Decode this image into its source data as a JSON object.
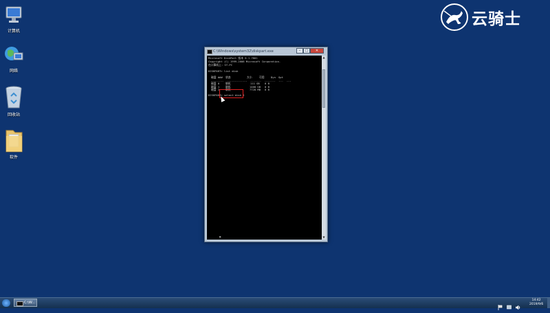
{
  "desktop": {
    "icons": [
      {
        "label": "计算机",
        "icon": "computer-icon"
      },
      {
        "label": "网络",
        "icon": "network-icon"
      },
      {
        "label": "回收站",
        "icon": "recycle-bin-icon"
      },
      {
        "label": "软件",
        "icon": "folder-icon"
      }
    ],
    "background_color": "#0e3470"
  },
  "watermark": {
    "text": "云骑士"
  },
  "cmd_window": {
    "title": "C:\\Windows\\system32\\diskpart.exe",
    "lines": {
      "l1": "Microsoft DiskPart 版本 6.1.7601",
      "l2": "Copyright (C) 1999-2008 Microsoft Corporation.",
      "l3": "在计算机上: ST-PC",
      "l4": "DISKPART> list disk",
      "l5": "DISKPART> select disk 2",
      "l6": "■"
    },
    "table": {
      "headers": [
        "磁盘 ###",
        "状态",
        "大小",
        "可用",
        "Dyn",
        "Gpt"
      ],
      "rows": [
        [
          "磁盘 0",
          "联机",
          "111 GB",
          "0 B",
          "",
          ""
        ],
        [
          "磁盘 1",
          "联机",
          "1468 GB",
          "0 B",
          "",
          ""
        ],
        [
          "磁盘 2",
          "联机",
          "7728 MB",
          "0 B",
          "",
          ""
        ]
      ]
    }
  },
  "taskbar": {
    "app_label": "C:\\W...",
    "clock_time": "14:42",
    "clock_date": "2019/9/6"
  }
}
